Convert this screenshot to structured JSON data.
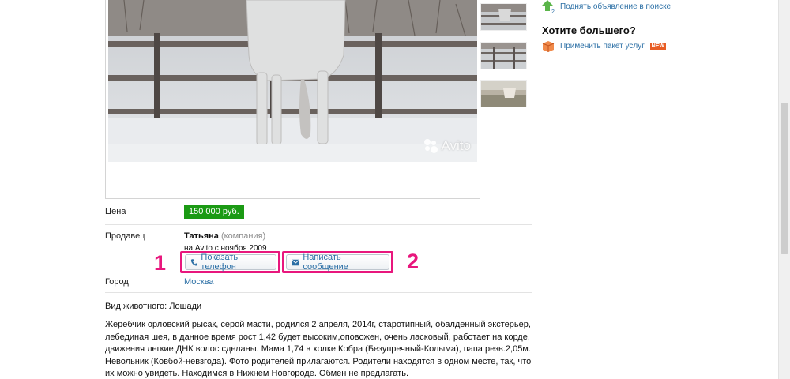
{
  "listing": {
    "price_label": "Цена",
    "price": "150 000 руб.",
    "seller_label": "Продавец",
    "seller_name": "Татьяна",
    "seller_type": "(компания)",
    "seller_since": "на Avito с ноября 2009",
    "show_phone_label": "Показать телефон",
    "write_message_label": "Написать сообщение",
    "city_label": "Город",
    "city": "Москва",
    "animal_type": "Вид животного: Лошади",
    "description": "Жеребчик орловский рысак, серой масти, родился 2 апреля, 2014г, старотипный, обалденный экстерьер, лебединая шея, в данное время рост 1,42 будет высоким,оповожен, очень ласковый, работает на корде, движения легкие.ДНК волос сделаны. Мама 1,74 в холке Кобра (Безупречный-Колыма), папа резв.2,05м. Невольник (Ковбой-невзгода). Фото родителей прилагаются. Родители находятся в одном месте, так, что их можно увидеть. Находимся в Нижнем Новгороде. Обмен не предлагать."
  },
  "photo": {
    "watermark": "Avito"
  },
  "sidebar": {
    "raise_link": "Поднять объявление в поиске",
    "promo_title": "Хотите большего?",
    "package_link": "Применить пакет услуг",
    "new_badge": "NEW"
  },
  "annotations": {
    "marker_1": "1",
    "marker_2": "2"
  },
  "colors": {
    "price_badge": "#1b9a14",
    "link": "#2b6fa5",
    "highlight": "#e8177d",
    "new_badge": "#e85d25"
  },
  "icons": {
    "phone_button": "phone-icon",
    "message_button": "envelope-icon",
    "raise_link": "up-arrow-icon",
    "package_link": "package-box-icon"
  }
}
